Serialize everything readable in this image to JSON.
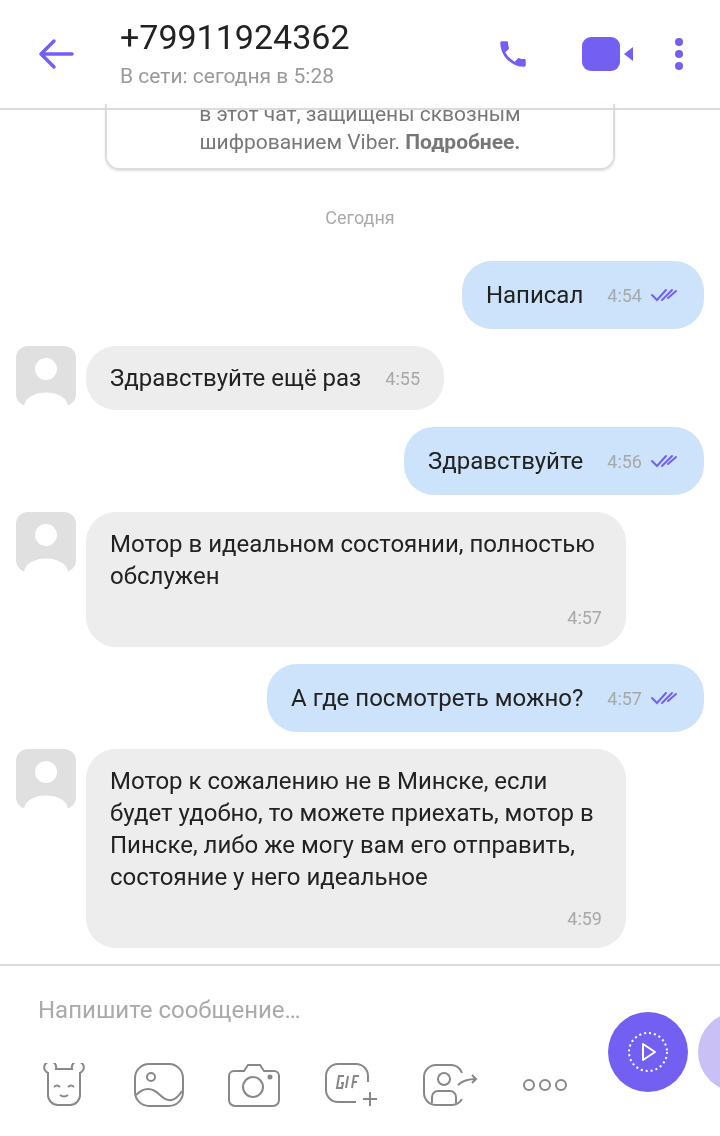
{
  "header": {
    "title": "+79911924362",
    "status": "В сети: сегодня в 5:28"
  },
  "notice": {
    "lines": [
      "в этот чат, защищены сквозным",
      "шифрованием Viber. **Подробнее.**"
    ]
  },
  "date_divider": "Сегодня",
  "messages": [
    {
      "kind": "out",
      "text": "Написал",
      "time": "4:54",
      "read": true
    },
    {
      "kind": "in",
      "text": "Здравствуйте ещё раз",
      "time": "4:55"
    },
    {
      "kind": "out",
      "text": "Здравствуйте",
      "time": "4:56",
      "read": true
    },
    {
      "kind": "in",
      "text": "Мотор в идеальном состоянии, полностью обслужен",
      "time": "4:57"
    },
    {
      "kind": "out",
      "text": "А где посмотреть можно?",
      "time": "4:57",
      "read": true
    },
    {
      "kind": "in",
      "text": "Мотор к сожалению не в Минске, если будет удобно, то можете приехать, мотор в Пинске, либо же могу вам его отправить, состояние у него идеальное",
      "time": "4:59"
    }
  ],
  "composer": {
    "placeholder": "Напишите сообщение…"
  }
}
